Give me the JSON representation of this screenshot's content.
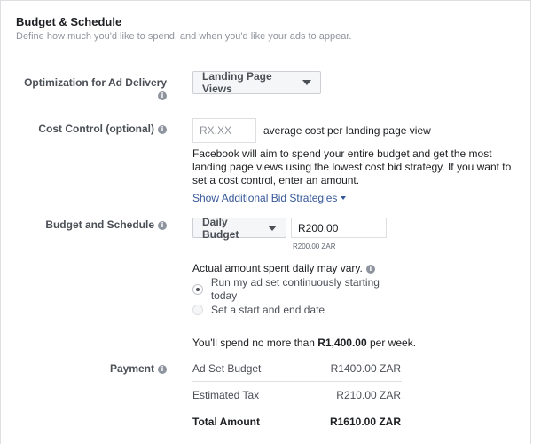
{
  "header": {
    "title": "Budget & Schedule",
    "subtitle": "Define how much you'd like to spend, and when you'd like your ads to appear."
  },
  "optimization": {
    "label": "Optimization for Ad Delivery",
    "value": "Landing Page Views"
  },
  "cost_control": {
    "label": "Cost Control (optional)",
    "placeholder": "RX.XX",
    "suffix": "average cost per landing page view",
    "help": "Facebook will aim to spend your entire budget and get the most landing page views using the lowest cost bid strategy. If you want to set a cost control, enter an amount.",
    "link": "Show Additional Bid Strategies"
  },
  "budget": {
    "label": "Budget and Schedule",
    "type": "Daily Budget",
    "amount": "R200.00",
    "amount_hint": "R200.00 ZAR",
    "note": "Actual amount spent daily may vary.",
    "options": [
      {
        "label": "Run my ad set continuously starting today",
        "checked": true
      },
      {
        "label": "Set a start and end date",
        "checked": false
      }
    ],
    "spend_prefix": "You'll spend no more than ",
    "spend_amount": "R1,400.00",
    "spend_suffix": " per week."
  },
  "payment": {
    "label": "Payment",
    "rows": [
      {
        "name": "Ad Set Budget",
        "value": "R1400.00 ZAR"
      },
      {
        "name": "Estimated Tax",
        "value": "R210.00 ZAR"
      },
      {
        "name": "Total Amount",
        "value": "R1610.00 ZAR"
      }
    ]
  }
}
